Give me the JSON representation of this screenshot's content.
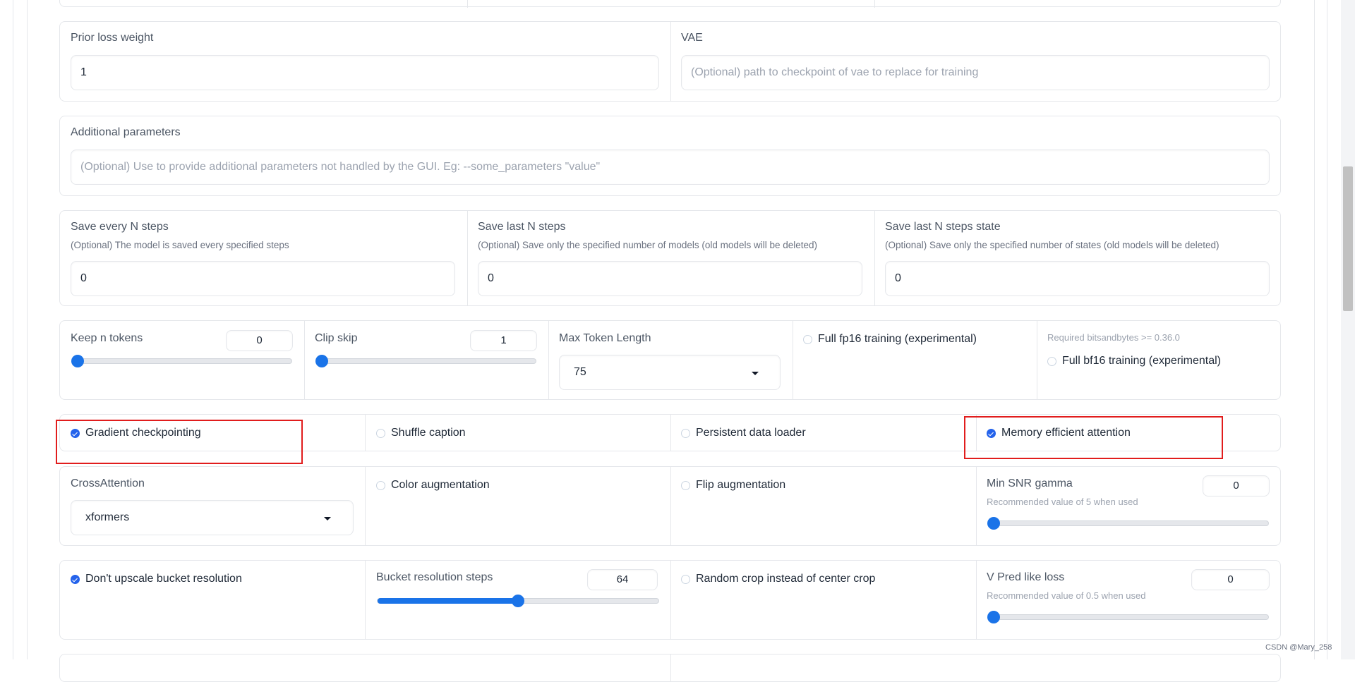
{
  "row_top": {},
  "prior_loss": {
    "label": "Prior loss weight",
    "value": "1"
  },
  "vae": {
    "label": "VAE",
    "placeholder": "(Optional) path to checkpoint of vae to replace for training"
  },
  "additional": {
    "label": "Additional parameters",
    "placeholder": "(Optional) Use to provide additional parameters not handled by the GUI. Eg: --some_parameters \"value\""
  },
  "save_every": {
    "label": "Save every N steps",
    "hint": "(Optional) The model is saved every specified steps",
    "value": "0"
  },
  "save_last": {
    "label": "Save last N steps",
    "hint": "(Optional) Save only the specified number of models (old models will be deleted)",
    "value": "0"
  },
  "save_last_state": {
    "label": "Save last N steps state",
    "hint": "(Optional) Save only the specified number of states (old models will be deleted)",
    "value": "0"
  },
  "keep_tokens": {
    "label": "Keep n tokens",
    "value": "0",
    "fraction": 0.0
  },
  "clip_skip": {
    "label": "Clip skip",
    "value": "1",
    "fraction": 0.0
  },
  "max_token": {
    "label": "Max Token Length",
    "value": "75"
  },
  "fp16": {
    "label": "Full fp16 training (experimental)",
    "checked": false
  },
  "bf16": {
    "note": "Required bitsandbytes >= 0.36.0",
    "label": "Full bf16 training (experimental)",
    "checked": false
  },
  "gradient_checkpointing": {
    "label": "Gradient checkpointing",
    "checked": true
  },
  "shuffle_caption": {
    "label": "Shuffle caption",
    "checked": false
  },
  "persistent_loader": {
    "label": "Persistent data loader",
    "checked": false
  },
  "mem_eff_attn": {
    "label": "Memory efficient attention",
    "checked": true
  },
  "cross_attention": {
    "label": "CrossAttention",
    "value": "xformers"
  },
  "color_aug": {
    "label": "Color augmentation",
    "checked": false
  },
  "flip_aug": {
    "label": "Flip augmentation",
    "checked": false
  },
  "min_snr": {
    "label": "Min SNR gamma",
    "hint": "Recommended value of 5 when used",
    "value": "0",
    "fraction": 0.0
  },
  "no_upscale": {
    "label": "Don't upscale bucket resolution",
    "checked": true
  },
  "bucket_steps": {
    "label": "Bucket resolution steps",
    "value": "64",
    "fraction": 0.5
  },
  "random_crop": {
    "label": "Random crop instead of center crop",
    "checked": false
  },
  "vpred": {
    "label": "V Pred like loss",
    "hint": "Recommended value of 0.5 when used",
    "value": "0",
    "fraction": 0.0
  },
  "watermark": "CSDN @Mary_258"
}
